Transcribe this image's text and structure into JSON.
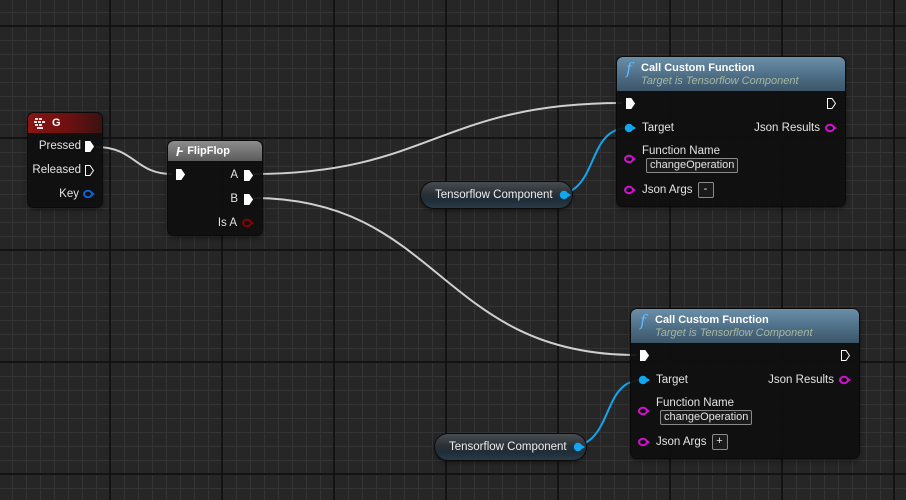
{
  "graph": {
    "nodes": {
      "key_event": {
        "title": "G",
        "icon": "keyboard-icon",
        "pins": [
          {
            "label": "Pressed",
            "type": "exec-out",
            "connected": true
          },
          {
            "label": "Released",
            "type": "exec-out",
            "connected": false
          },
          {
            "label": "Key",
            "type": "struct-out",
            "color": "#0b63d6"
          }
        ]
      },
      "flipflop": {
        "title": "FlipFlop",
        "icon": "flipflop-icon",
        "pins": [
          {
            "label": "",
            "type": "exec-in",
            "connected": true
          },
          {
            "label": "A",
            "type": "exec-out",
            "connected": true
          },
          {
            "label": "B",
            "type": "exec-out",
            "connected": true
          },
          {
            "label": "Is A",
            "type": "bool-out",
            "color": "#8c0000"
          }
        ]
      },
      "call_1": {
        "title": "Call Custom Function",
        "subtitle": "Target is Tensorflow Component",
        "icon": "function-icon",
        "target_label": "Target",
        "function_name_label": "Function Name",
        "function_name_value": "changeOperation",
        "json_args_label": "Json Args",
        "json_args_button": "-",
        "json_results_label": "Json Results"
      },
      "call_2": {
        "title": "Call Custom Function",
        "subtitle": "Target is Tensorflow Component",
        "icon": "function-icon",
        "target_label": "Target",
        "function_name_label": "Function Name",
        "function_name_value": "changeOperation",
        "json_args_label": "Json Args",
        "json_args_button": "+",
        "json_results_label": "Json Results"
      },
      "var_1": {
        "label": "Tensorflow Component"
      },
      "var_2": {
        "label": "Tensorflow Component"
      }
    },
    "colors": {
      "exec_wire": "#d8d8d8",
      "object_pin": "#11a6f0",
      "json_pin": "#d40fd4",
      "bool_pin": "#8c0000",
      "struct_pin": "#0b63d6",
      "key_header": "#8a1414",
      "flipflop_header": "#7a7a7a",
      "function_header": "#5a7f99"
    }
  }
}
